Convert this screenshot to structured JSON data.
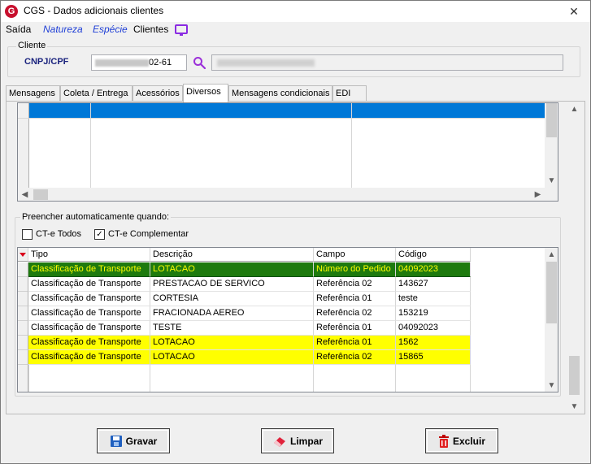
{
  "window": {
    "title": "CGS - Dados adicionais clientes",
    "logo_letter": "G",
    "close_glyph": "✕"
  },
  "menu": {
    "saida": "Saída",
    "natureza": "Natureza",
    "especie": "Espécie",
    "clientes": "Clientes"
  },
  "cliente": {
    "legend": "Cliente",
    "cnpj_label": "CNPJ/CPF",
    "cnpj_value_suffix": "02-61"
  },
  "tabs": [
    {
      "label": "Mensagens"
    },
    {
      "label": "Coleta / Entrega"
    },
    {
      "label": "Acessórios"
    },
    {
      "label": "Diversos"
    },
    {
      "label": "Mensagens condicionais"
    },
    {
      "label": "EDI"
    }
  ],
  "active_tab": "Diversos",
  "auto": {
    "legend": "Preencher automaticamente quando:",
    "ct_todos": {
      "label": "CT-e Todos",
      "checked": false
    },
    "ct_complementar": {
      "label": "CT-e Complementar",
      "checked": true,
      "mark": "✓"
    }
  },
  "grid2": {
    "headers": [
      "Tipo",
      "Descrição",
      "Campo",
      "Código"
    ],
    "rows": [
      [
        "Classificação de Transporte",
        "LOTACAO",
        "Número do Pedido",
        "04092023"
      ],
      [
        "Classificação de Transporte",
        "PRESTACAO DE SERVICO",
        "Referência 02",
        "143627"
      ],
      [
        "Classificação de Transporte",
        "CORTESIA",
        "Referência 01",
        "teste"
      ],
      [
        "Classificação de Transporte",
        "FRACIONADA AEREO",
        "Referência 02",
        "153219"
      ],
      [
        "Classificação de Transporte",
        "TESTE",
        "Referência 01",
        "04092023"
      ],
      [
        "Classificação de Transporte",
        "LOTACAO",
        "Referência 01",
        "1562"
      ],
      [
        "Classificação de Transporte",
        "LOTACAO",
        "Referência 02",
        "15865"
      ]
    ]
  },
  "buttons": {
    "gravar": "Gravar",
    "limpar": "Limpar",
    "excluir": "Excluir"
  },
  "colors": {
    "selected_row": "#1e7a0e",
    "selected_text": "#ffff00",
    "highlight_row": "#ffff00",
    "grid1_selected": "#0078d7"
  }
}
